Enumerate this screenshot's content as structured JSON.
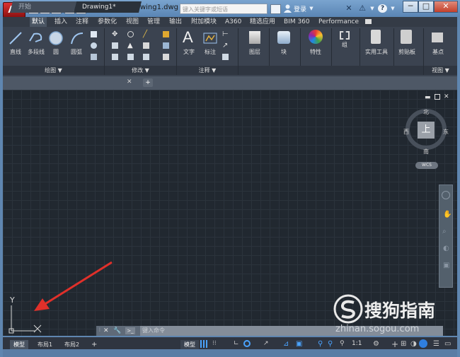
{
  "window": {
    "doc_title": "Drawing1.dwg",
    "search_placeholder": "键入关键字或短语",
    "login": "登录",
    "help": "?",
    "app_letter": "A"
  },
  "ribbon": {
    "tabs": [
      "默认",
      "插入",
      "注释",
      "参数化",
      "视图",
      "管理",
      "输出",
      "附加模块",
      "A360",
      "精选应用",
      "BIM 360",
      "Performance"
    ],
    "active_tab": "默认",
    "draw_buttons": [
      "直线",
      "多段线",
      "圆",
      "圆弧"
    ],
    "annot_buttons": [
      "文字",
      "标注"
    ],
    "big_buttons": [
      "图层",
      "块",
      "特性",
      "组",
      "实用工具",
      "剪贴板",
      "基点"
    ],
    "panel_footers": [
      "绘图",
      "修改",
      "注释",
      "视图"
    ]
  },
  "filetabs": {
    "start": "开始",
    "drawing": "Drawing1*",
    "add": "+"
  },
  "viewcube": {
    "top": "上",
    "north": "北",
    "south": "南",
    "west": "西",
    "east": "东",
    "wcs": "WCS"
  },
  "ucs": {
    "y": "Y",
    "x": "X"
  },
  "command": {
    "placeholder": "键入命令"
  },
  "layout_tabs": [
    "模型",
    "布局1",
    "布局2"
  ],
  "status": {
    "model": "模型",
    "scale": "1:1"
  },
  "watermark": {
    "brand": "搜狗指南",
    "url": "zhinan.sogou.com"
  },
  "colors": {
    "accent_red": "#c01515",
    "arrow": "#e0302a",
    "canvas": "#212830"
  }
}
